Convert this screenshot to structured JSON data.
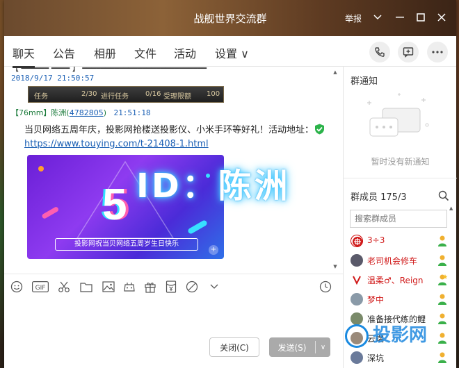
{
  "window": {
    "title": "战舰世界交流群",
    "report_label": "举报"
  },
  "tabs": [
    {
      "label": "聊天",
      "active": true
    },
    {
      "label": "公告"
    },
    {
      "label": "相册"
    },
    {
      "label": "文件"
    },
    {
      "label": "活动"
    },
    {
      "label": "设置 ∨"
    }
  ],
  "chat": {
    "prev_time": "2018/9/17 21:50:57",
    "task_strip": {
      "task_label": "任务",
      "task_count": "2/30",
      "running_label": "进行任务",
      "running_count": "0/16",
      "accept_label": "受理限额",
      "accept_count": "100"
    },
    "message": {
      "sender_tag": "【76mm】陈洲(",
      "sender_id": "4782805",
      "sender_close": ")",
      "time": "21:51:18",
      "text": "当贝网络五周年庆，投影网抢楼送投影仪、小米手环等好礼！活动地址：",
      "link": "https://www.touying.com/t-21408-1.html",
      "promo_number": "5",
      "promo_caption": "投影网祝当贝网络五周岁生日快乐"
    },
    "overlay_text": "ID：陈洲"
  },
  "composer": {
    "close_label": "关闭(C)",
    "send_label": "发送(S)"
  },
  "sidebar": {
    "notice_title": "群通知",
    "notice_empty": "暂时没有新通知",
    "members_title": "群成员 175/3",
    "search_placeholder": "搜索群成员",
    "members": [
      {
        "name": "3÷3",
        "color": "#d01818"
      },
      {
        "name": "老司机会修车",
        "color": "#d01818"
      },
      {
        "name": "温柔♂、Reign",
        "color": "#d01818"
      },
      {
        "name": "梦中",
        "color": "#d01818"
      },
      {
        "name": "准备接代练的鲤",
        "color": "#222222"
      },
      {
        "name": "云端",
        "color": "#222222"
      },
      {
        "name": "深坑",
        "color": "#222222"
      }
    ]
  },
  "watermark": "投影网"
}
